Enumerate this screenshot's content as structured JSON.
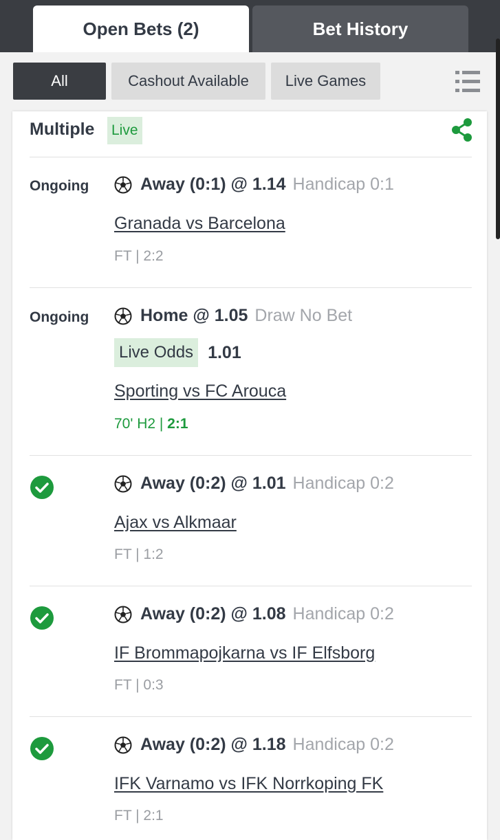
{
  "tabs": {
    "open_bets": "Open Bets (2)",
    "bet_history": "Bet History"
  },
  "filters": {
    "all": "All",
    "cashout": "Cashout Available",
    "live_games": "Live Games"
  },
  "bet": {
    "type": "Multiple",
    "live_badge": "Live",
    "selections": [
      {
        "status": "Ongoing",
        "pick": "Away (0:1) @ 1.14",
        "market": "Handicap 0:1",
        "match": "Granada vs Barcelona",
        "score": "FT | 2:2"
      },
      {
        "status": "Ongoing",
        "pick": "Home @ 1.05",
        "market": "Draw No Bet",
        "live_odds_label": "Live Odds",
        "live_odds_value": "1.01",
        "match": "Sporting vs FC Arouca",
        "score_time": "70' H2",
        "score_sep": " | ",
        "score_value": "2:1"
      },
      {
        "status": "won",
        "pick": "Away (0:2) @ 1.01",
        "market": "Handicap 0:2",
        "match": "Ajax vs Alkmaar",
        "score": "FT | 1:2"
      },
      {
        "status": "won",
        "pick": "Away (0:2) @ 1.08",
        "market": "Handicap 0:2",
        "match": "IF Brommapojkarna vs IF Elfsborg",
        "score": "FT | 0:3"
      },
      {
        "status": "won",
        "pick": "Away (0:2) @ 1.18",
        "market": "Handicap 0:2",
        "match": "IFK Varnamo vs IFK Norrkoping FK",
        "score": "FT | 2:1"
      }
    ]
  },
  "colors": {
    "accent_green": "#1d9a3d",
    "dark": "#3a3d42",
    "muted": "#a3a6ab"
  },
  "icons": {
    "share": "share-icon",
    "list": "list-view-icon",
    "ball": "soccer-ball-icon",
    "check": "check-circle-icon"
  }
}
